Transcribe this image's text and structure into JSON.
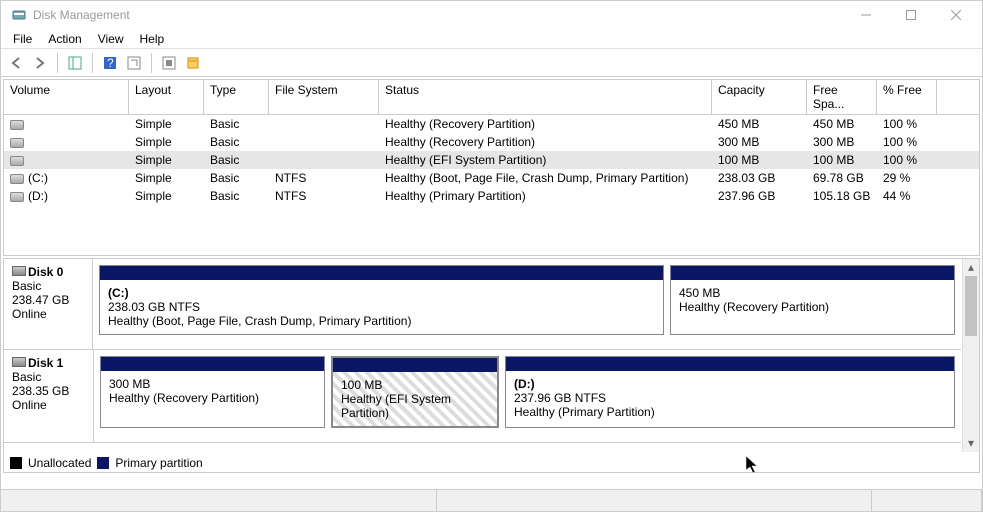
{
  "window": {
    "title": "Disk Management"
  },
  "menus": [
    "File",
    "Action",
    "View",
    "Help"
  ],
  "columns": {
    "volume": "Volume",
    "layout": "Layout",
    "type": "Type",
    "fs": "File System",
    "status": "Status",
    "capacity": "Capacity",
    "free": "Free Spa...",
    "pct": "% Free"
  },
  "volumes": [
    {
      "name": "",
      "layout": "Simple",
      "type": "Basic",
      "fs": "",
      "status": "Healthy (Recovery Partition)",
      "capacity": "450 MB",
      "free": "450 MB",
      "pct": "100 %",
      "selected": false
    },
    {
      "name": "",
      "layout": "Simple",
      "type": "Basic",
      "fs": "",
      "status": "Healthy (Recovery Partition)",
      "capacity": "300 MB",
      "free": "300 MB",
      "pct": "100 %",
      "selected": false
    },
    {
      "name": "",
      "layout": "Simple",
      "type": "Basic",
      "fs": "",
      "status": "Healthy (EFI System Partition)",
      "capacity": "100 MB",
      "free": "100 MB",
      "pct": "100 %",
      "selected": true
    },
    {
      "name": "(C:)",
      "layout": "Simple",
      "type": "Basic",
      "fs": "NTFS",
      "status": "Healthy (Boot, Page File, Crash Dump, Primary Partition)",
      "capacity": "238.03 GB",
      "free": "69.78 GB",
      "pct": "29 %",
      "selected": false
    },
    {
      "name": "(D:)",
      "layout": "Simple",
      "type": "Basic",
      "fs": "NTFS",
      "status": "Healthy (Primary Partition)",
      "capacity": "237.96 GB",
      "free": "105.18 GB",
      "pct": "44 %",
      "selected": false
    }
  ],
  "disks": [
    {
      "name": "Disk 0",
      "type": "Basic",
      "size": "238.47 GB",
      "state": "Online",
      "parts": [
        {
          "label": "(C:)",
          "line2": "238.03 GB NTFS",
          "line3": "Healthy (Boot, Page File, Crash Dump, Primary Partition)",
          "flex": 565,
          "kind": "primary",
          "selected": false
        },
        {
          "label": "",
          "line2": "450 MB",
          "line3": "Healthy (Recovery Partition)",
          "flex": 285,
          "kind": "primary",
          "selected": false
        }
      ]
    },
    {
      "name": "Disk 1",
      "type": "Basic",
      "size": "238.35 GB",
      "state": "Online",
      "parts": [
        {
          "label": "",
          "line2": "300 MB",
          "line3": "Healthy (Recovery Partition)",
          "flex": 225,
          "kind": "primary",
          "selected": false
        },
        {
          "label": "",
          "line2": "100 MB",
          "line3": "Healthy (EFI System Partition)",
          "flex": 168,
          "kind": "efi",
          "selected": true
        },
        {
          "label": "(D:)",
          "line2": "237.96 GB NTFS",
          "line3": "Healthy (Primary Partition)",
          "flex": 450,
          "kind": "primary",
          "selected": false
        }
      ]
    }
  ],
  "legend": {
    "unallocated": "Unallocated",
    "primary": "Primary partition"
  }
}
